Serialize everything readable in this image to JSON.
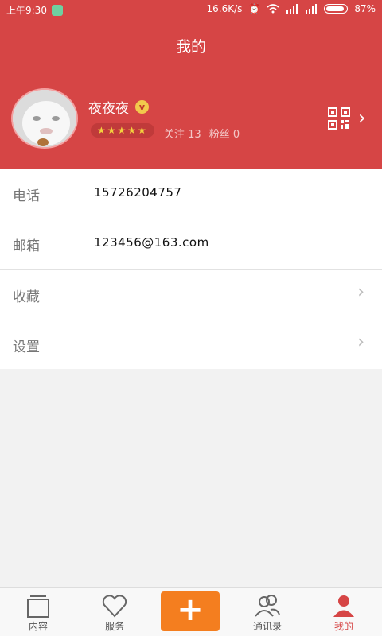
{
  "status_bar": {
    "time": "上午9:30",
    "network_speed": "16.6K/s",
    "battery": "87%",
    "battery_level": 0.87
  },
  "header": {
    "title": "我的",
    "bg_color": "#d64545"
  },
  "profile": {
    "nickname": "夜夜夜",
    "vip_badge": "v",
    "stars": "★★★★★",
    "follow_label": "关注",
    "follow_count": "13",
    "fans_label": "粉丝",
    "fans_count": "0"
  },
  "info": [
    {
      "label": "电话",
      "value": "15726204757"
    },
    {
      "label": "邮箱",
      "value": "123456@163.com"
    }
  ],
  "menu": [
    {
      "label": "收藏"
    },
    {
      "label": "设置"
    }
  ],
  "tabbar": {
    "tabs": [
      {
        "label": "内容",
        "icon": "content-icon"
      },
      {
        "label": "服务",
        "icon": "heart-icon"
      },
      {
        "label": "",
        "icon": "add-icon"
      },
      {
        "label": "通讯录",
        "icon": "contacts-icon"
      },
      {
        "label": "我的",
        "icon": "person-icon"
      }
    ],
    "active_color": "#d64545",
    "add_color": "#f47e1f"
  }
}
